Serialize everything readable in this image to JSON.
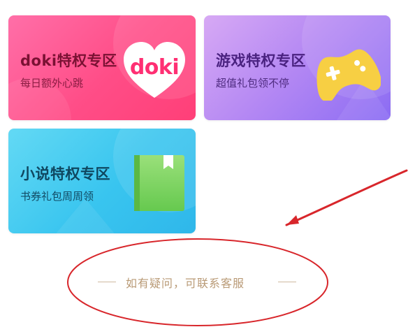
{
  "cards": [
    {
      "title": "doki特权专区",
      "subtitle": "每日额外心跳",
      "logo_text": "doki"
    },
    {
      "title": "游戏特权专区",
      "subtitle": "超值礼包领不停"
    },
    {
      "title": "小说特权专区",
      "subtitle": "书券礼包周周领"
    }
  ],
  "footer": {
    "text": "如有疑问，可联系客服"
  },
  "icons": {
    "doki": "doki-heart-icon",
    "game": "gamepad-icon",
    "novel": "green-book-icon"
  },
  "colors": {
    "doki_card": "#ff4d87",
    "game_card": "#9b78f4",
    "novel_card": "#39c5ef",
    "annotation_red": "#d8262b",
    "footer_text": "#b99a76"
  }
}
